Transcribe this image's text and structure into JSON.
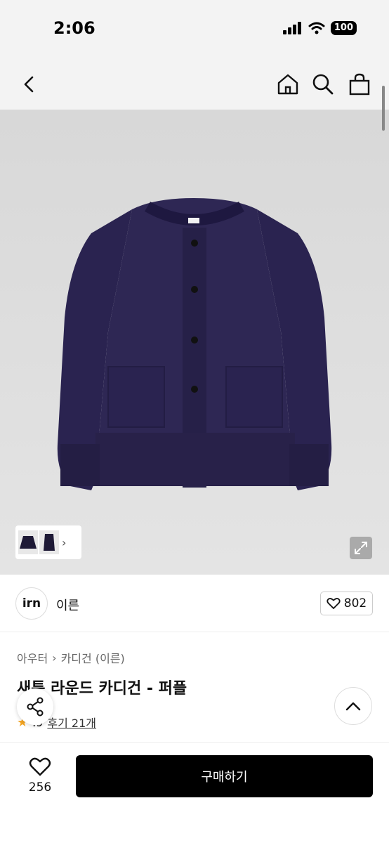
{
  "status_bar": {
    "time": "2:06",
    "battery": "100"
  },
  "nav": {
    "icons": [
      "back-icon",
      "home-icon",
      "search-icon",
      "shopping-bag-icon"
    ]
  },
  "brand": {
    "logo_text": "irn",
    "name": "이른",
    "likes": "802"
  },
  "breadcrumb": {
    "category": "아우터",
    "subcategory": "카디건 (이른)"
  },
  "product": {
    "title": "새틋 라운드 카디건 - 퍼플",
    "rating": ".9",
    "reviews": "후기 21개"
  },
  "bottom": {
    "wishlist_count": "256",
    "buy_label": "구매하기"
  },
  "colors": {
    "garment": "#2c2550",
    "buy_button": "#000000"
  }
}
